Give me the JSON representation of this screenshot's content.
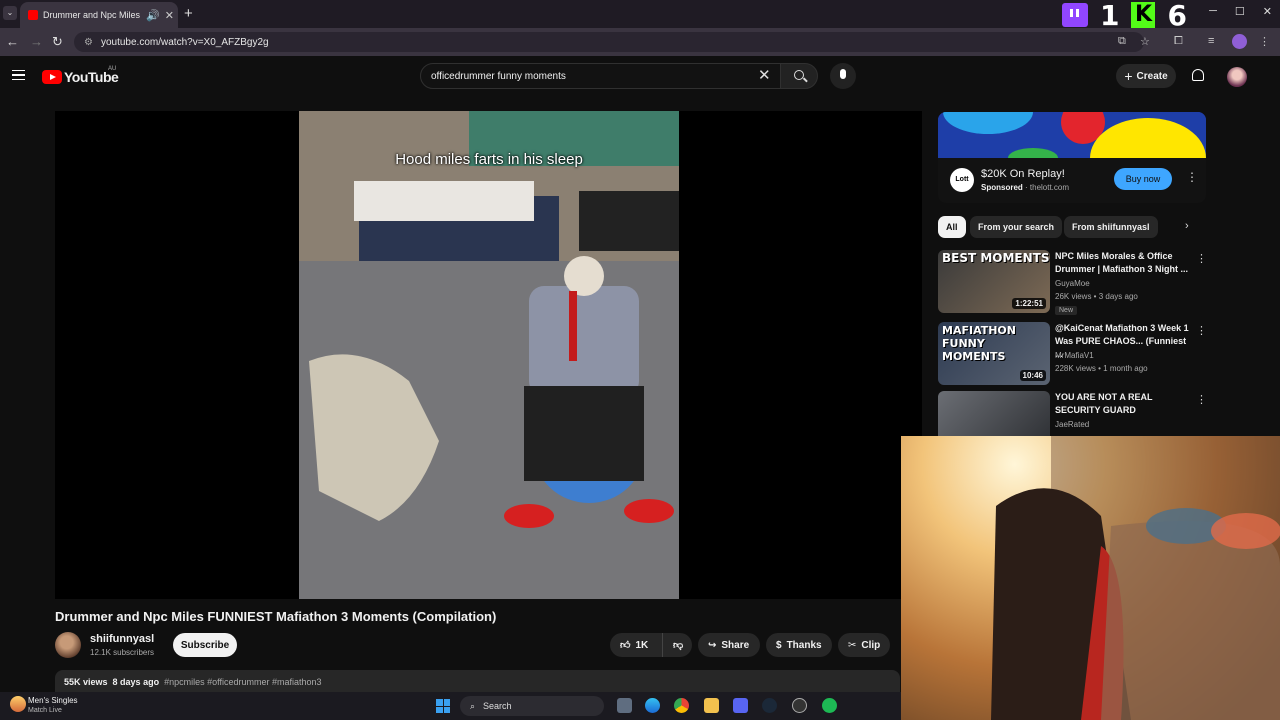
{
  "browser": {
    "tab_title": "Drummer and Npc Miles FUNNIEST Mafiathon 3 Moments (Compilation)",
    "tab_close": "✕",
    "new_tab": "+",
    "url": "youtube.com/watch?v=X0_AFZBgy2g",
    "window_controls": [
      "─",
      "☐",
      "✕"
    ]
  },
  "stream_overlay": {
    "counter_left": "1",
    "counter_right": "6"
  },
  "youtube": {
    "logo_text": "YouTube",
    "region": "AU",
    "search_query": "officedrummer funny moments",
    "create_label": "Create"
  },
  "video": {
    "caption": "Hood miles farts in his sleep",
    "title": "Drummer and Npc Miles FUNNIEST Mafiathon 3 Moments (Compilation)",
    "channel_name": "shiifunnyasl",
    "channel_subs": "12.1K subscribers",
    "subscribe_label": "Subscribe",
    "like_count": "1K",
    "share_label": "Share",
    "thanks_label": "Thanks",
    "clip_label": "Clip",
    "views": "55K views",
    "age": "8 days ago",
    "hashtags": "#npcmiles #officedrummer #mafiathon3"
  },
  "ad": {
    "logo_text": "Lott",
    "title": "$20K On Replay!",
    "sponsored_label": "Sponsored",
    "domain": "thelott.com",
    "cta": "Buy now"
  },
  "chips": [
    "All",
    "From your search",
    "From shiifunnyasl"
  ],
  "recommendations": [
    {
      "title": "NPC Miles Morales & Office Drummer | Mafiathon 3 Night ...",
      "channel": "GuyaMoe",
      "stats": "26K views • 3 days ago",
      "badge": "New",
      "duration": "1:22:51",
      "thumb_text": "BEST MOMENTS"
    },
    {
      "title": "@KaiCenat Mafiathon 3 Week 1 Was PURE CHAOS... (Funniest ...",
      "channel": "MrMafiaV1",
      "stats": "228K views • 1 month ago",
      "badge": "",
      "duration": "10:46",
      "thumb_text": "MAFIATHON FUNNY MOMENTS"
    },
    {
      "title": "YOU ARE NOT A REAL SECURITY GUARD",
      "channel": "JaeRated",
      "stats": "",
      "badge": "",
      "duration": "",
      "thumb_text": ""
    }
  ],
  "taskbar": {
    "widget_title": "Men's Singles",
    "widget_sub": "Match Live",
    "search_label": "Search"
  }
}
